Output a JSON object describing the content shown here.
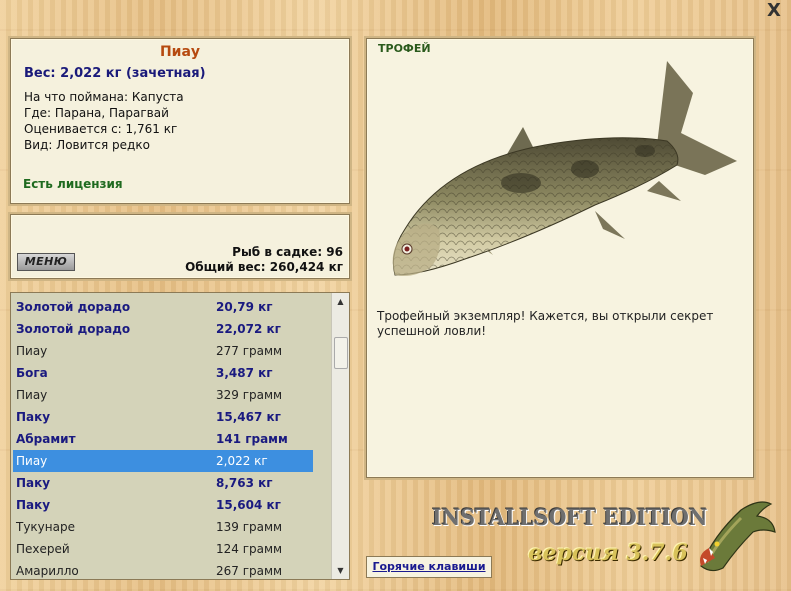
{
  "window": {
    "close_label": "X"
  },
  "info": {
    "fish_name": "Пиау",
    "weight_line": "Вес: 2,022 кг (зачетная)",
    "bait": "На что поймана: Капуста",
    "location": "Где: Парана, Парагвай",
    "rated_from": "Оценивается с: 1,761 кг",
    "rarity": "Вид: Ловится редко",
    "license": "Есть лицензия"
  },
  "keep": {
    "menu_label": "МЕНЮ",
    "fish_count": "Рыб в садке: 96",
    "total_weight": "Общий вес: 260,424 кг"
  },
  "catch_list": [
    {
      "name": "Золотой дорадо",
      "weight": "20,79 кг",
      "style": "bold"
    },
    {
      "name": "Золотой дорадо",
      "weight": "22,072 кг",
      "style": "bold"
    },
    {
      "name": "Пиау",
      "weight": "277 грамм",
      "style": "plain"
    },
    {
      "name": "Бога",
      "weight": "3,487 кг",
      "style": "bold"
    },
    {
      "name": "Пиау",
      "weight": "329 грамм",
      "style": "plain"
    },
    {
      "name": "Паку",
      "weight": "15,467 кг",
      "style": "bold"
    },
    {
      "name": "Абрамит",
      "weight": "141 грамм",
      "style": "bold"
    },
    {
      "name": "Пиау",
      "weight": "2,022 кг",
      "style": "selected"
    },
    {
      "name": "Паку",
      "weight": "8,763 кг",
      "style": "bold"
    },
    {
      "name": "Паку",
      "weight": "15,604 кг",
      "style": "bold"
    },
    {
      "name": "Тукунаре",
      "weight": "139 грамм",
      "style": "plain"
    },
    {
      "name": "Пехерей",
      "weight": "124 грамм",
      "style": "plain"
    },
    {
      "name": "Амарилло",
      "weight": "267 грамм",
      "style": "plain"
    }
  ],
  "trophy": {
    "heading": "ТРОФЕЙ",
    "text": "Трофейный экземпляр! Кажется, вы открыли секрет успешной ловли!"
  },
  "footer": {
    "hotkeys_label": "Горячие клавиши",
    "edition": "INSTALLSOFT EDITION",
    "version": "версия 3.7.6"
  },
  "colors": {
    "selected_row": "#3d8fe0",
    "title": "#b64a10",
    "bold_row": "#1a1a80",
    "license": "#1f6a1f"
  }
}
